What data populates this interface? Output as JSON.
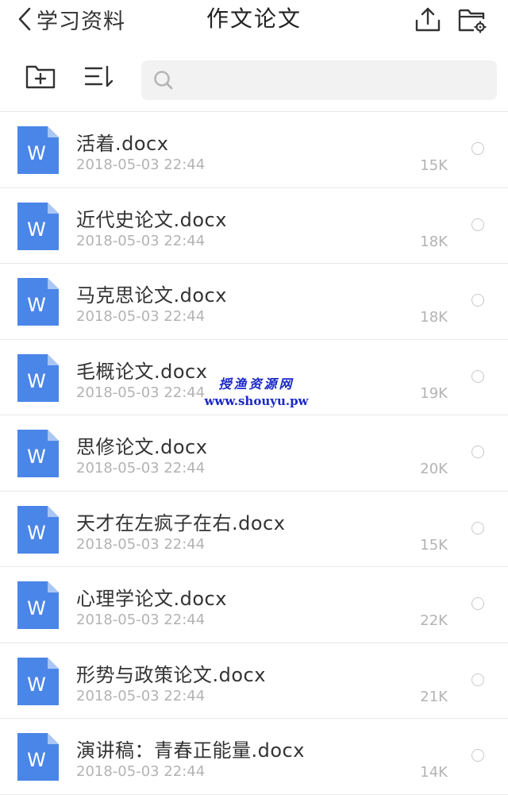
{
  "navbar": {
    "back_label": "学习资料",
    "title": "作文论文"
  },
  "search": {
    "placeholder": ""
  },
  "files": [
    {
      "name": "活着.docx",
      "date": "2018-05-03 22:44",
      "size": "15K"
    },
    {
      "name": "近代史论文.docx",
      "date": "2018-05-03 22:44",
      "size": "18K"
    },
    {
      "name": "马克思论文.docx",
      "date": "2018-05-03 22:44",
      "size": "18K"
    },
    {
      "name": "毛概论文.docx",
      "date": "2018-05-03 22:44",
      "size": "19K"
    },
    {
      "name": "思修论文.docx",
      "date": "2018-05-03 22:44",
      "size": "20K"
    },
    {
      "name": "天才在左疯子在右.docx",
      "date": "2018-05-03 22:44",
      "size": "15K"
    },
    {
      "name": "心理学论文.docx",
      "date": "2018-05-03 22:44",
      "size": "22K"
    },
    {
      "name": "形势与政策论文.docx",
      "date": "2018-05-03 22:44",
      "size": "21K"
    },
    {
      "name": "演讲稿：青春正能量.docx",
      "date": "2018-05-03 22:44",
      "size": "14K"
    }
  ],
  "file_icon_letter": "W",
  "colors": {
    "word_blue": "#4a86e8",
    "watermark": "#1a28c8"
  },
  "watermark": {
    "cn": "授渔资源网",
    "url": "www.shouyu.pw"
  }
}
